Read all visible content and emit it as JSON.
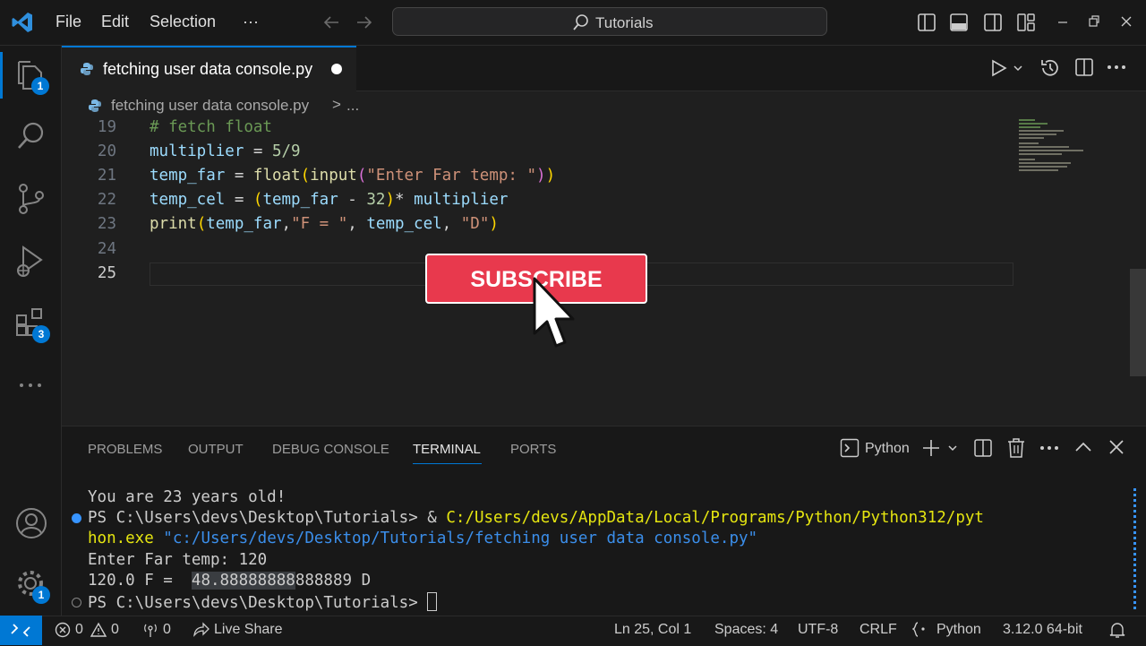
{
  "menu": {
    "file": "File",
    "edit": "Edit",
    "selection": "Selection",
    "more": "···"
  },
  "search": {
    "label": "Tutorials"
  },
  "activity": {
    "explorer_badge": "1",
    "extensions_badge": "3",
    "settings_badge": "1"
  },
  "tab": {
    "title": "fetching user data console.py"
  },
  "breadcrumb": {
    "file": "fetching user data console.py",
    "sep": ">",
    "more": "..."
  },
  "editor": {
    "line_numbers": [
      "19",
      "20",
      "21",
      "22",
      "23",
      "24",
      "25"
    ],
    "lines": {
      "l19": "# fetch float",
      "l20_a": "multiplier",
      "l20_b": " = ",
      "l20_c": "5/9",
      "l21_a": "temp_far",
      "l21_b": " = ",
      "l21_c": "float",
      "l21_d": "(",
      "l21_e": "input",
      "l21_f": "(",
      "l21_g": "\"Enter Far temp: \"",
      "l21_h": ")",
      "l21_i": ")",
      "l22_a": "temp_cel",
      "l22_b": " = ",
      "l22_c": "(",
      "l22_d": "temp_far",
      "l22_e": " - ",
      "l22_f": "32",
      "l22_g": ")",
      "l22_h": "* ",
      "l22_i": "multiplier",
      "l23_a": "print",
      "l23_b": "(",
      "l23_c": "temp_far",
      "l23_d": ",",
      "l23_e": "\"F = \"",
      "l23_f": ", ",
      "l23_g": "temp_cel",
      "l23_h": ", ",
      "l23_i": "\"D\"",
      "l23_j": ")"
    }
  },
  "overlay": {
    "subscribe": "SUBSCRIBE"
  },
  "panel": {
    "tabs": [
      "PROBLEMS",
      "OUTPUT",
      "DEBUG CONSOLE",
      "TERMINAL",
      "PORTS"
    ],
    "terminal_profile": "Python",
    "terminal": {
      "line1": "You are 23 years old!",
      "line2_prompt": "PS C:\\Users\\devs\\Desktop\\Tutorials> ",
      "line2_amp": "& ",
      "line2_path": "C:/Users/devs/AppData/Local/Programs/Python/Python312/pyt",
      "line3_path": "hon.exe",
      "line3_arg": " \"c:/Users/devs/Desktop/Tutorials/fetching user data console.py\"",
      "line4": "Enter Far temp: 120",
      "line5_a": "120.0 F =  ",
      "line5_sel": "48.88888888",
      "line5_b": "888889 D",
      "line6": "PS C:\\Users\\devs\\Desktop\\Tutorials> "
    }
  },
  "status": {
    "errors": "0",
    "warnings": "0",
    "ports": "0",
    "live_share": "Live Share",
    "position": "Ln 25, Col 1",
    "spaces": "Spaces: 4",
    "encoding": "UTF-8",
    "eol": "CRLF",
    "language": "Python",
    "interpreter": "3.12.0 64-bit"
  },
  "colors": {
    "accent": "#0078d4",
    "subscribe": "#e8394d"
  }
}
